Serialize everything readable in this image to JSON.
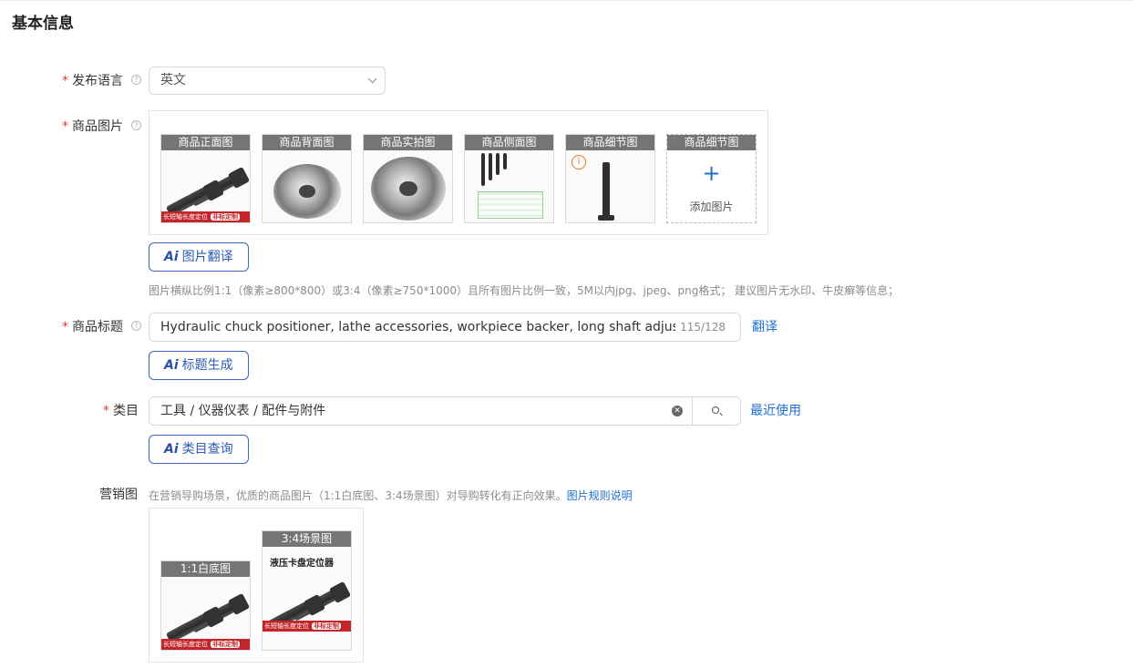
{
  "section": {
    "title": "基本信息"
  },
  "language": {
    "label": "发布语言",
    "required_mark": "*",
    "selected": "英文"
  },
  "product_images": {
    "label": "商品图片",
    "required_mark": "*",
    "thumbs": [
      {
        "caption": "商品正面图"
      },
      {
        "caption": "商品背面图"
      },
      {
        "caption": "商品实拍图"
      },
      {
        "caption": "商品侧面图"
      },
      {
        "caption": "商品细节图"
      },
      {
        "caption": "商品细节图",
        "add_text": "添加图片"
      }
    ],
    "ai_button": "图片翻译",
    "hint": "图片横纵比例1:1（像素≥800*800）或3:4（像素≥750*1000）且所有图片比例一致，5M以内jpg、jpeg、png格式； 建议图片无水印、牛皮癣等信息；",
    "banner_left": "长短轴长度定位",
    "banner_right": "非标定制"
  },
  "product_title": {
    "label": "商品标题",
    "required_mark": "*",
    "value": "Hydraulic chuck positioner, lathe accessories, workpiece backer, long shaft adjustable dust c",
    "count": "115/128",
    "translate_link": "翻译",
    "ai_button": "标题生成"
  },
  "category": {
    "label": "类目",
    "required_mark": "*",
    "value": "工具 / 仪器仪表 / 配件与附件",
    "recent_link": "最近使用",
    "ai_button": "类目查询"
  },
  "marketing": {
    "label": "营销图",
    "desc": "在营销导购场景，优质的商品图片（1:1白底图、3:4场景图）对导购转化有正向效果。",
    "desc_link": "图片规则说明",
    "thumbs": [
      {
        "caption": "1:1白底图"
      },
      {
        "caption": "3:4场景图",
        "subtitle": "液压卡盘定位器"
      }
    ]
  },
  "colors": {
    "accent": "#1f6fd1",
    "required": "#e4393c",
    "banner_red": "#c3262a"
  }
}
